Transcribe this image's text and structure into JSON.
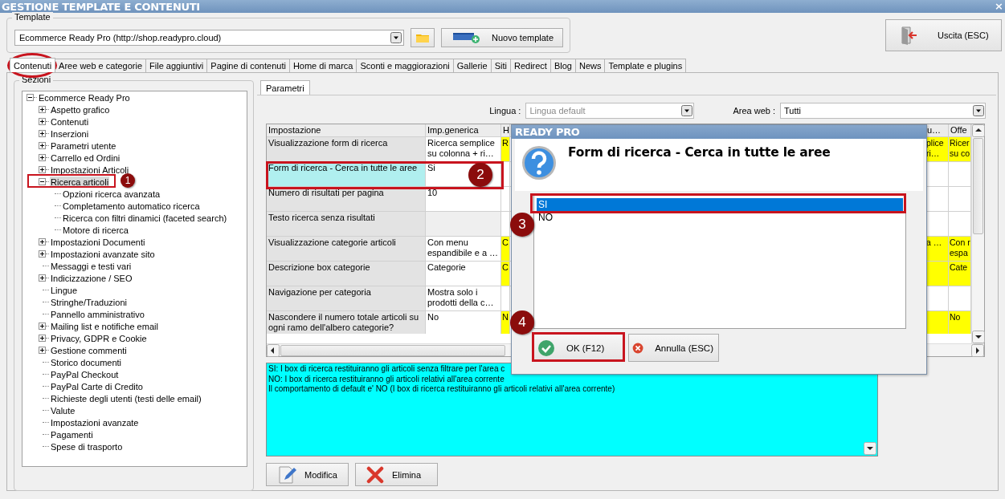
{
  "window": {
    "title": "GESTIONE TEMPLATE E CONTENUTI",
    "close": "×"
  },
  "template": {
    "label": "Template",
    "value": "Ecommerce Ready Pro (http://shop.readypro.cloud)",
    "new_button": "Nuovo template"
  },
  "exit_button": "Uscita (ESC)",
  "tabs": [
    {
      "label": "Contenuti",
      "selected": true
    },
    {
      "label": "Aree web e categorie",
      "selected": false
    },
    {
      "label": "File aggiuntivi",
      "selected": false
    },
    {
      "label": "Pagine di contenuti",
      "selected": false
    },
    {
      "label": "Home di marca",
      "selected": false
    },
    {
      "label": "Sconti e maggiorazioni",
      "selected": false
    },
    {
      "label": "Gallerie",
      "selected": false
    },
    {
      "label": "Siti",
      "selected": false
    },
    {
      "label": "Redirect",
      "selected": false
    },
    {
      "label": "Blog",
      "selected": false
    },
    {
      "label": "News",
      "selected": false
    },
    {
      "label": "Template e plugins",
      "selected": false
    }
  ],
  "sections": {
    "label": "Sezioni",
    "tree": [
      {
        "label": "Ecommerce Ready Pro",
        "expanded": true,
        "selected": false,
        "children": [
          {
            "label": "Aspetto grafico",
            "expanded": false,
            "selected": false
          },
          {
            "label": "Contenuti",
            "expanded": false,
            "selected": false
          },
          {
            "label": "Inserzioni",
            "expanded": false,
            "selected": false
          },
          {
            "label": "Parametri utente",
            "expanded": false,
            "selected": false
          },
          {
            "label": "Carrello ed Ordini",
            "expanded": false,
            "selected": false
          },
          {
            "label": "Impostazioni Articoli",
            "expanded": false,
            "selected": false
          },
          {
            "label": "Ricerca articoli",
            "expanded": true,
            "selected": true,
            "children": [
              {
                "label": "Opzioni ricerca avanzata",
                "selected": false
              },
              {
                "label": "Completamento automatico ricerca",
                "selected": false
              },
              {
                "label": "Ricerca con filtri dinamici (faceted search)",
                "selected": false
              },
              {
                "label": "Motore di ricerca",
                "selected": false
              }
            ]
          },
          {
            "label": "Impostazioni Documenti",
            "expanded": false,
            "selected": false
          },
          {
            "label": "Impostazioni avanzate sito",
            "expanded": false,
            "selected": false
          },
          {
            "label": "Messaggi e testi vari",
            "selected": false
          },
          {
            "label": "Indicizzazione / SEO",
            "expanded": false,
            "selected": false
          },
          {
            "label": "Lingue",
            "selected": false
          },
          {
            "label": "Stringhe/Traduzioni",
            "selected": false
          },
          {
            "label": "Pannello amministrativo",
            "selected": false
          },
          {
            "label": "Mailing list e notifiche email",
            "expanded": false,
            "selected": false
          },
          {
            "label": "Privacy, GDPR e Cookie",
            "expanded": false,
            "selected": false
          },
          {
            "label": "Gestione commenti",
            "expanded": false,
            "selected": false
          },
          {
            "label": "Storico documenti",
            "selected": false
          },
          {
            "label": "PayPal Checkout",
            "selected": false
          },
          {
            "label": "PayPal Carte di Credito",
            "selected": false
          },
          {
            "label": "Richieste degli utenti (testi delle email)",
            "selected": false
          },
          {
            "label": "Valute",
            "selected": false
          },
          {
            "label": "Impostazioni avanzate",
            "selected": false
          },
          {
            "label": "Pagamenti",
            "selected": false
          },
          {
            "label": "Spese di trasporto",
            "selected": false
          }
        ]
      }
    ]
  },
  "subtabs": [
    {
      "label": "Parametri",
      "selected": true
    }
  ],
  "filters": [
    {
      "label": "Lingua :",
      "value": "Lingua default",
      "disabled": true
    },
    {
      "label": "Area web :",
      "value": "Tutti",
      "disabled": false
    }
  ],
  "table": {
    "columns": [
      "Impostazione",
      "Imp.generica",
      "H",
      "u…",
      "Offe"
    ],
    "rows": [
      {
        "setting": "Visualizzazione form di ricerca",
        "generic": "Ricerca semplice su colonna + ri…",
        "column_3": "R",
        "column_4": "plice ri…",
        "column_5": "Ricer su co",
        "selected": false,
        "highlighted": true
      },
      {
        "setting": "Form di ricerca - Cerca in tutte le aree",
        "generic": "Si",
        "selected": true,
        "highlighted": false
      },
      {
        "setting": "Numero di risultati per pagina",
        "generic": "10",
        "selected": false,
        "highlighted": false
      },
      {
        "setting": "Testo ricerca senza risultati",
        "selected": false,
        "highlighted": false
      },
      {
        "setting": "Visualizzazione categorie articoli",
        "generic": "Con menu espandibile e a …",
        "column_3": "C",
        "column_4": "a …",
        "column_5": "Con r espa",
        "selected": false,
        "highlighted": true
      },
      {
        "setting": "Descrizione box categorie",
        "generic": "Categorie",
        "column_3": "C",
        "column_5": "Cate",
        "selected": false,
        "highlighted": true
      },
      {
        "setting": "Navigazione per categoria",
        "generic": "Mostra solo i prodotti della c…",
        "selected": false,
        "highlighted": false
      },
      {
        "setting": "Nascondere il numero totale articoli su ogni ramo dell'albero categorie?",
        "generic": "No",
        "column_3": "N",
        "column_5": "No",
        "selected": false,
        "highlighted": true
      }
    ]
  },
  "description": [
    "SI: I box di ricerca restituiranno gli articoli senza filtrare per l'area c",
    "NO: I box di ricerca restituiranno gli articoli relativi all'area corrente",
    "Il comportamento di default e' NO (I box di ricerca restituiranno gli articoli relativi all'area corrente)"
  ],
  "actions": [
    {
      "kind": "edit",
      "label": "Modifica"
    },
    {
      "kind": "delete",
      "label": "Elimina"
    }
  ],
  "dialog": {
    "title": "READY PRO",
    "heading": "Form di ricerca - Cerca in tutte le aree",
    "options": [
      {
        "label": "SI",
        "selected": true
      },
      {
        "label": "NO",
        "selected": false
      }
    ],
    "buttons": [
      {
        "kind": "ok",
        "label": "OK (F12)"
      },
      {
        "kind": "cancel",
        "label": "Annulla (ESC)"
      }
    ]
  },
  "annotations": [
    "1",
    "2",
    "3",
    "4"
  ]
}
